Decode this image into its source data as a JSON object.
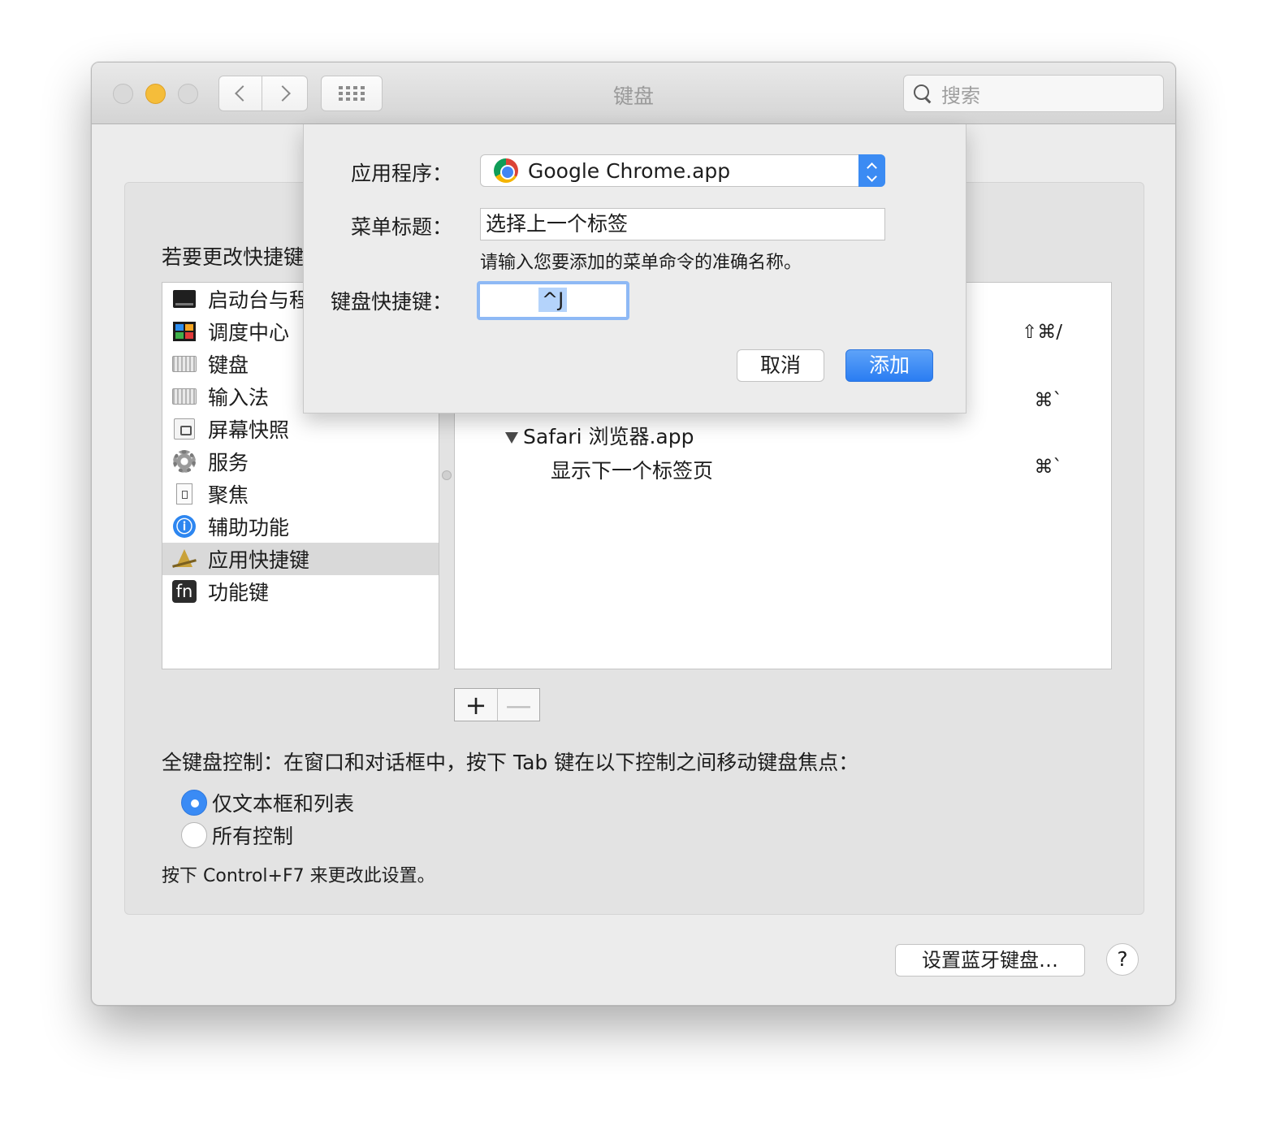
{
  "window": {
    "title": "键盘",
    "search_placeholder": "搜索"
  },
  "main": {
    "instruction": "若要更改快捷键",
    "categories": [
      {
        "label": "启动台与程序坞",
        "icon": "launchpad-icon"
      },
      {
        "label": "调度中心",
        "icon": "mission-control-icon"
      },
      {
        "label": "键盘",
        "icon": "keyboard-icon"
      },
      {
        "label": "输入法",
        "icon": "input-method-icon"
      },
      {
        "label": "屏幕快照",
        "icon": "screenshot-icon"
      },
      {
        "label": "服务",
        "icon": "gear-icon"
      },
      {
        "label": "聚焦",
        "icon": "spotlight-icon"
      },
      {
        "label": "辅助功能",
        "icon": "accessibility-icon"
      },
      {
        "label": "应用快捷键",
        "icon": "app-store-icon",
        "selected": true
      },
      {
        "label": "功能键",
        "icon": "fn-icon"
      }
    ],
    "shortcuts": {
      "row1_shortcut": "⇧⌘/",
      "row2_shortcut": "⌘`",
      "app_group": "Safari 浏览器.app",
      "app_item": "显示下一个标签页",
      "app_item_shortcut": "⌘`"
    },
    "plus_label": "+",
    "minus_label": "—",
    "full_keyboard_access": "全键盘控制：在窗口和对话框中，按下 Tab 键在以下控制之间移动键盘焦点：",
    "radio_options": [
      {
        "label": "仅文本框和列表",
        "selected": true
      },
      {
        "label": "所有控制",
        "selected": false
      }
    ],
    "note": "按下 Control+F7 来更改此设置。",
    "bluetooth_button": "设置蓝牙键盘…",
    "help_button": "?"
  },
  "sheet": {
    "app_label": "应用程序：",
    "app_value": "Google Chrome.app",
    "menu_title_label": "菜单标题：",
    "menu_title_value": "选择上一个标签",
    "hint": "请输入您要添加的菜单命令的准确名称。",
    "shortcut_label": "键盘快捷键：",
    "shortcut_value": "^J",
    "cancel_label": "取消",
    "add_label": "添加"
  }
}
